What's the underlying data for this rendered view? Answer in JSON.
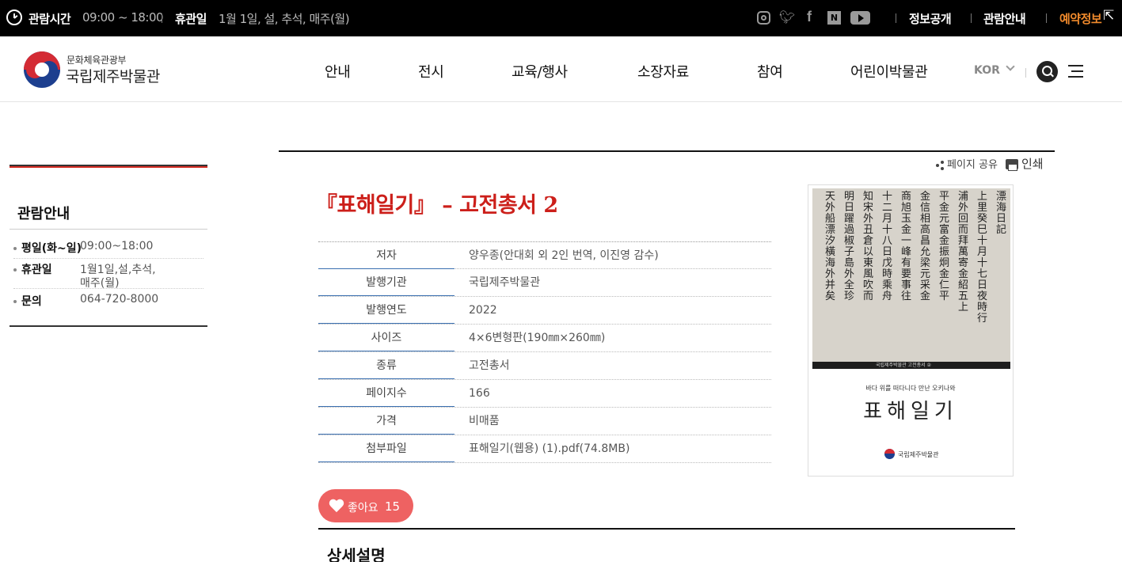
{
  "topbar": {
    "hours_label": "관람시간",
    "hours_value": "09:00 ~ 18:00",
    "closed_label": "휴관일",
    "closed_value": "1월 1일, 설, 추석, 매주(월)",
    "sns": [
      "instagram-icon",
      "twitter-icon",
      "facebook-icon",
      "naver-blog-icon",
      "youtube-icon"
    ],
    "links": [
      "정보공개",
      "관람안내",
      "예약정보"
    ],
    "accent": "#f08a2c"
  },
  "header": {
    "logo_sub": "문화체육관광부",
    "logo_main": "국립제주박물관",
    "gnb": [
      "안내",
      "전시",
      "교육/행사",
      "소장자료",
      "참여",
      "어린이박물관"
    ],
    "lang": "KOR"
  },
  "sidebar": {
    "title": "관람안내",
    "rows": [
      {
        "label": "평일(화~일)",
        "value": "09:00~18:00"
      },
      {
        "label": "휴관일",
        "value": "1월1일,설,추석,",
        "value2": "매주(월)"
      },
      {
        "label": "문의",
        "value": "064-720-8000"
      }
    ],
    "accent": "#d22b22"
  },
  "tools": {
    "share": "페이지 공유",
    "print": "인쇄"
  },
  "doc": {
    "title": "『표해일기』 – 고전총서 2",
    "title_color": "#cc1f1a",
    "rows": [
      {
        "key": "저자",
        "value": "양우종(안대회 외 2인 번역, 이진영 감수)"
      },
      {
        "key": "발행기관",
        "value": "국립제주박물관"
      },
      {
        "key": "발행연도",
        "value": "2022"
      },
      {
        "key": "사이즈",
        "value": "4×6변형판(190㎜×260㎜)"
      },
      {
        "key": "종류",
        "value": "고전총서"
      },
      {
        "key": "페이지수",
        "value": "166"
      },
      {
        "key": "가격",
        "value": "비매품"
      },
      {
        "key": "첨부파일",
        "value": "표해일기(웹용) (1).pdf(74.8MB)"
      }
    ]
  },
  "cover": {
    "columns": [
      "漂海日記",
      "上里癸巳十月十七日夜時行",
      "浦外回而拜萬寄金紹五上",
      "平金元富金振炯金仁平",
      "金信相高昌允梁元采金",
      "商旭玉金一峰有要事往",
      "十二月十八日戊時乘舟",
      "知宋外丑倉以東風吹而",
      "明日躍過椒子島外全珍",
      "天外船漂汐橫海外并矣"
    ],
    "band": "국립제주박물관 고전총서 ②",
    "subtitle": "바다 위를 떠다니다 만난 오키나와",
    "title": "표해일기",
    "publisher": "국립제주박물관"
  },
  "like": {
    "label": "좋아요",
    "count": "15",
    "color": "#ee6262"
  },
  "detail": {
    "title": "상세설명"
  }
}
